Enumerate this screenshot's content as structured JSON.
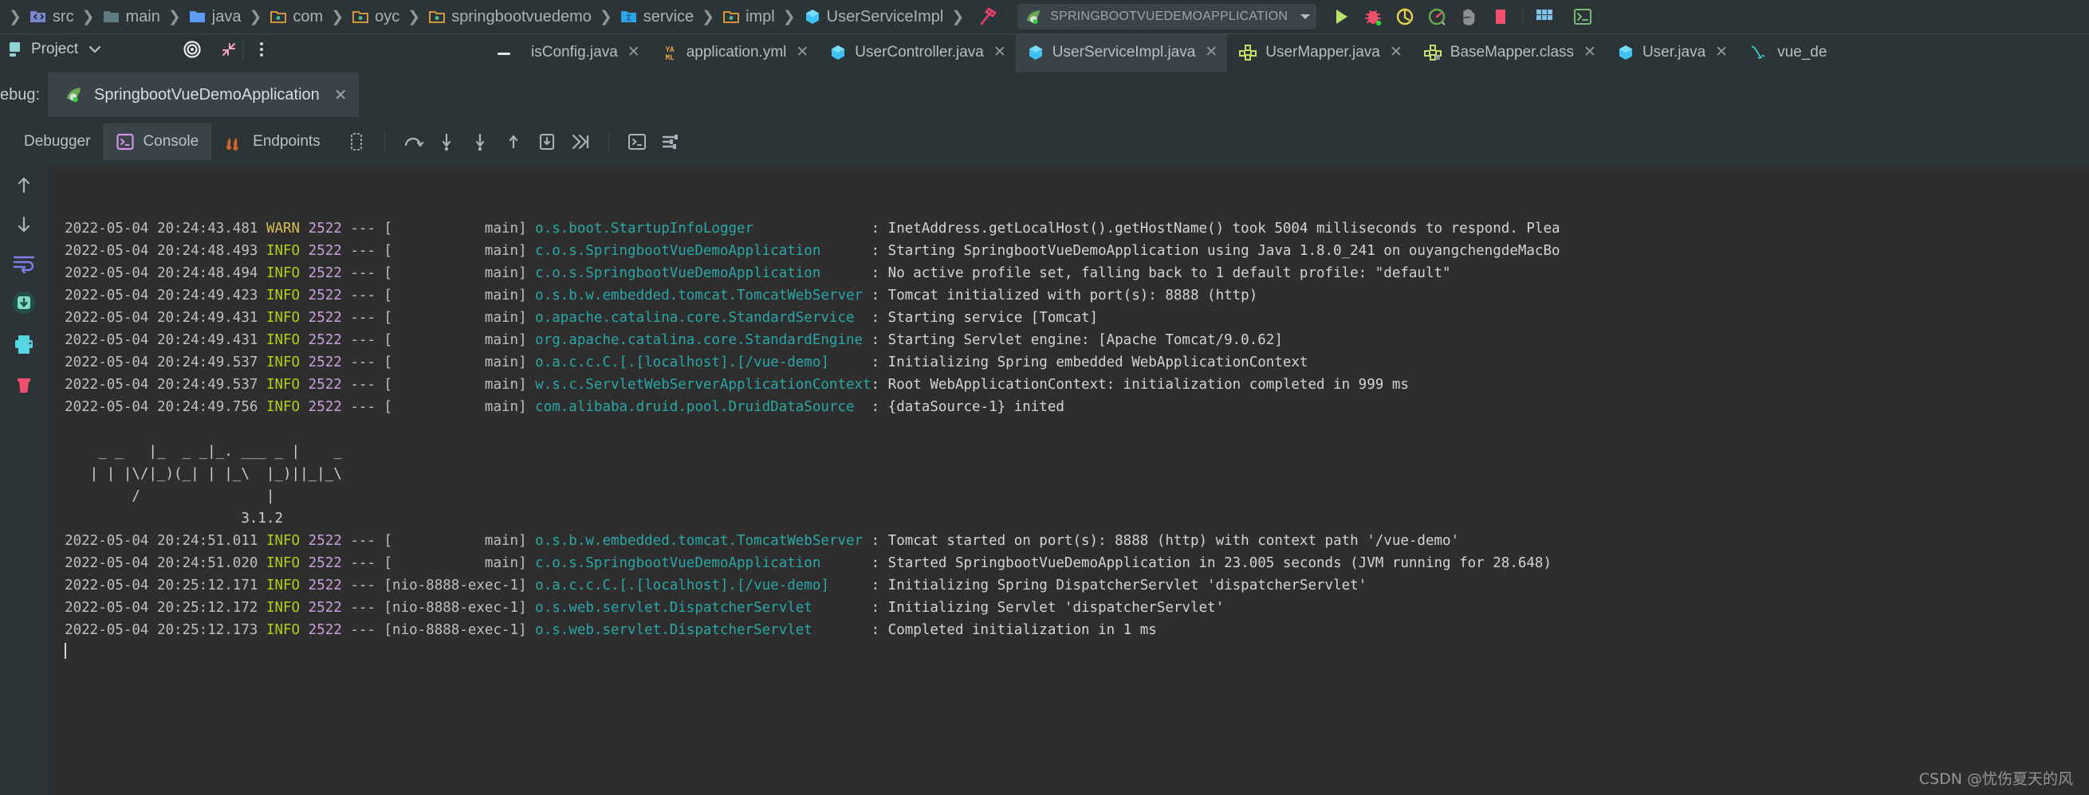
{
  "breadcrumb": [
    {
      "label": "src",
      "icon": "source-folder-icon"
    },
    {
      "label": "main",
      "icon": "folder-icon"
    },
    {
      "label": "java",
      "icon": "java-source-folder-icon"
    },
    {
      "label": "com",
      "icon": "package-folder-icon"
    },
    {
      "label": "oyc",
      "icon": "package-folder-icon"
    },
    {
      "label": "springbootvuedemo",
      "icon": "package-folder-icon"
    },
    {
      "label": "service",
      "icon": "spring-service-folder-icon"
    },
    {
      "label": "impl",
      "icon": "package-folder-icon"
    },
    {
      "label": "UserServiceImpl",
      "icon": "java-class-icon"
    }
  ],
  "toolbar": {
    "build_icon": "hammer-icon",
    "run_config_name": "SPRINGBOOTVUEDEMOAPPLICATION",
    "run_config_icon": "spring-boot-icon",
    "dropdown_icon": "chevron-down-icon",
    "actions": [
      {
        "name": "run-button",
        "icon": "run-icon"
      },
      {
        "name": "debug-button",
        "icon": "debug-bug-icon"
      },
      {
        "name": "run-with-coverage-button",
        "icon": "coverage-icon"
      },
      {
        "name": "profiler-button",
        "icon": "profiler-icon"
      },
      {
        "name": "attach-process-button",
        "icon": "hand-icon"
      },
      {
        "name": "stop-button",
        "icon": "stop-icon"
      },
      {
        "name": "services-button",
        "icon": "grid-icon"
      },
      {
        "name": "terminal-button",
        "icon": "terminal-icon"
      }
    ]
  },
  "project_panel": {
    "title": "Project",
    "dropdown_icon": "chevron-down-icon",
    "locate_icon": "target-icon",
    "collapse_icon": "collapse-all-icon",
    "options_icon": "more-options-icon",
    "hide_icon": "hide-icon"
  },
  "editor_tabs": [
    {
      "label": "isConfig.java",
      "icon": "minus-icon",
      "active": false
    },
    {
      "label": "application.yml",
      "icon": "yaml-icon",
      "active": false
    },
    {
      "label": "UserController.java",
      "icon": "java-class-icon",
      "active": false
    },
    {
      "label": "UserServiceImpl.java",
      "icon": "java-class-icon",
      "active": true
    },
    {
      "label": "UserMapper.java",
      "icon": "mybatis-mapper-icon",
      "active": false
    },
    {
      "label": "BaseMapper.class",
      "icon": "mybatis-mapper-icon",
      "active": false
    },
    {
      "label": "User.java",
      "icon": "java-class-icon",
      "active": false
    },
    {
      "label": "vue_de",
      "icon": "mysql-icon",
      "active": false
    }
  ],
  "debug_window": {
    "title": "ebug:",
    "session_name": "SpringbootVueDemoApplication",
    "session_icon": "spring-boot-icon",
    "session_close_icon": "close-icon",
    "tabs": [
      {
        "label": "Debugger",
        "icon": "",
        "active": false
      },
      {
        "label": "Console",
        "icon": "console-icon",
        "active": true
      },
      {
        "label": "Endpoints",
        "icon": "endpoints-icon",
        "active": false
      }
    ],
    "toolbar_icons": [
      "layout-settings-icon",
      "step-over-icon",
      "step-into-icon",
      "force-step-into-icon",
      "step-out-icon",
      "drop-frame-icon",
      "run-to-cursor-icon",
      "evaluate-expression-icon",
      "settings-sliders-icon"
    ],
    "gutter_icons": [
      "scroll-up-icon",
      "scroll-down-icon",
      "soft-wrap-icon",
      "scroll-to-end-icon",
      "print-icon",
      "clear-all-icon"
    ]
  },
  "console": {
    "lines": [
      {
        "type": "log",
        "ts": "2022-05-04 20:24:43.481",
        "level": "WARN",
        "pid": "2522",
        "thread": "main",
        "logger": "o.s.boot.StartupInfoLogger",
        "message": "InetAddress.getLocalHost().getHostName() took 5004 milliseconds to respond. Plea"
      },
      {
        "type": "log",
        "ts": "2022-05-04 20:24:48.493",
        "level": "INFO",
        "pid": "2522",
        "thread": "main",
        "logger": "c.o.s.SpringbootVueDemoApplication",
        "message": "Starting SpringbootVueDemoApplication using Java 1.8.0_241 on ouyangchengdeMacBo"
      },
      {
        "type": "log",
        "ts": "2022-05-04 20:24:48.494",
        "level": "INFO",
        "pid": "2522",
        "thread": "main",
        "logger": "c.o.s.SpringbootVueDemoApplication",
        "message": "No active profile set, falling back to 1 default profile: \"default\""
      },
      {
        "type": "log",
        "ts": "2022-05-04 20:24:49.423",
        "level": "INFO",
        "pid": "2522",
        "thread": "main",
        "logger": "o.s.b.w.embedded.tomcat.TomcatWebServer",
        "message": "Tomcat initialized with port(s): 8888 (http)"
      },
      {
        "type": "log",
        "ts": "2022-05-04 20:24:49.431",
        "level": "INFO",
        "pid": "2522",
        "thread": "main",
        "logger": "o.apache.catalina.core.StandardService",
        "message": "Starting service [Tomcat]"
      },
      {
        "type": "log",
        "ts": "2022-05-04 20:24:49.431",
        "level": "INFO",
        "pid": "2522",
        "thread": "main",
        "logger": "org.apache.catalina.core.StandardEngine",
        "message": "Starting Servlet engine: [Apache Tomcat/9.0.62]"
      },
      {
        "type": "log",
        "ts": "2022-05-04 20:24:49.537",
        "level": "INFO",
        "pid": "2522",
        "thread": "main",
        "logger": "o.a.c.c.C.[.[localhost].[/vue-demo]",
        "message": "Initializing Spring embedded WebApplicationContext"
      },
      {
        "type": "log",
        "ts": "2022-05-04 20:24:49.537",
        "level": "INFO",
        "pid": "2522",
        "thread": "main",
        "logger": "w.s.c.ServletWebServerApplicationContext",
        "message": "Root WebApplicationContext: initialization completed in 999 ms"
      },
      {
        "type": "log",
        "ts": "2022-05-04 20:24:49.756",
        "level": "INFO",
        "pid": "2522",
        "thread": "main",
        "logger": "com.alibaba.druid.pool.DruidDataSource",
        "message": "{dataSource-1} inited"
      },
      {
        "type": "blank"
      },
      {
        "type": "banner",
        "text": "    _ _   |_  _ _|_. ___ _ |    _"
      },
      {
        "type": "banner",
        "text": "   | | |\\/|_)(_| | |_\\  |_)||_|_\\"
      },
      {
        "type": "banner",
        "text": "        /               |"
      },
      {
        "type": "banner",
        "text": "                     3.1.2"
      },
      {
        "type": "log",
        "ts": "2022-05-04 20:24:51.011",
        "level": "INFO",
        "pid": "2522",
        "thread": "main",
        "logger": "o.s.b.w.embedded.tomcat.TomcatWebServer",
        "message": "Tomcat started on port(s): 8888 (http) with context path '/vue-demo'"
      },
      {
        "type": "log",
        "ts": "2022-05-04 20:24:51.020",
        "level": "INFO",
        "pid": "2522",
        "thread": "main",
        "logger": "c.o.s.SpringbootVueDemoApplication",
        "message": "Started SpringbootVueDemoApplication in 23.005 seconds (JVM running for 28.648)"
      },
      {
        "type": "log",
        "ts": "2022-05-04 20:25:12.171",
        "level": "INFO",
        "pid": "2522",
        "thread": "nio-8888-exec-1",
        "logger": "o.a.c.c.C.[.[localhost].[/vue-demo]",
        "message": "Initializing Spring DispatcherServlet 'dispatcherServlet'"
      },
      {
        "type": "log",
        "ts": "2022-05-04 20:25:12.172",
        "level": "INFO",
        "pid": "2522",
        "thread": "nio-8888-exec-1",
        "logger": "o.s.web.servlet.DispatcherServlet",
        "message": "Initializing Servlet 'dispatcherServlet'"
      },
      {
        "type": "log",
        "ts": "2022-05-04 20:25:12.173",
        "level": "INFO",
        "pid": "2522",
        "thread": "nio-8888-exec-1",
        "logger": "o.s.web.servlet.DispatcherServlet",
        "message": "Completed initialization in 1 ms"
      },
      {
        "type": "caret"
      }
    ]
  },
  "watermark": "CSDN @忧伤夏天的风",
  "colors": {
    "background": "#2c3438",
    "console_bg": "#2e2e2e",
    "tab_active": "#3a4347",
    "logger": "#2aa7a7",
    "info": "#b5cc18",
    "warn": "#d6bf55",
    "pid": "#c9a0dc",
    "text": "#d4d4d4"
  }
}
